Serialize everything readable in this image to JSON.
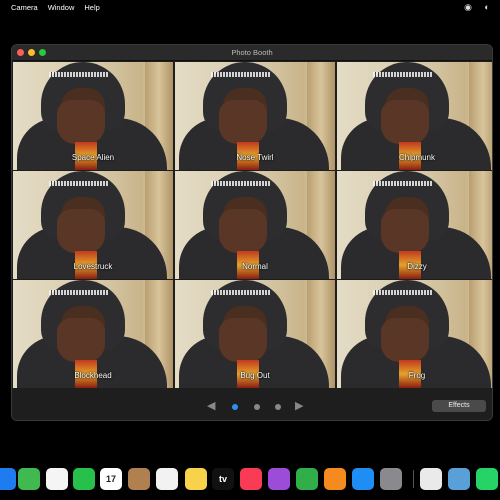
{
  "menubar": {
    "items": [
      "Camera",
      "Window",
      "Help"
    ],
    "status_icons": [
      "record-icon",
      "control-center-icon"
    ]
  },
  "window": {
    "title": "Photo Booth",
    "effects": [
      {
        "label": "Space Alien"
      },
      {
        "label": "Nose Twirl"
      },
      {
        "label": "Chipmunk"
      },
      {
        "label": "Lovestruck"
      },
      {
        "label": "Normal"
      },
      {
        "label": "Dizzy"
      },
      {
        "label": "Blockhead"
      },
      {
        "label": "Bug Out"
      },
      {
        "label": "Frog"
      }
    ],
    "pager": {
      "pages": 3,
      "current": 1
    },
    "effects_button": "Effects"
  },
  "dock": {
    "apps": [
      {
        "name": "finder-icon",
        "color": "#1e7bf0"
      },
      {
        "name": "maps-icon",
        "color": "#3fb950"
      },
      {
        "name": "photos-icon",
        "color": "#f5f5f5"
      },
      {
        "name": "facetime-icon",
        "color": "#27c04a"
      },
      {
        "name": "calendar-icon",
        "color": "#ffffff",
        "text": "17"
      },
      {
        "name": "contacts-icon",
        "color": "#b08050"
      },
      {
        "name": "reminders-icon",
        "color": "#f2f2f2"
      },
      {
        "name": "notes-icon",
        "color": "#f7d24a"
      },
      {
        "name": "apple-tv-icon",
        "color": "#111111",
        "text": "tv"
      },
      {
        "name": "music-icon",
        "color": "#fa3b55"
      },
      {
        "name": "podcasts-icon",
        "color": "#9c4dd8"
      },
      {
        "name": "numbers-icon",
        "color": "#2fae4a"
      },
      {
        "name": "pages-icon",
        "color": "#f58a1f"
      },
      {
        "name": "app-store-icon",
        "color": "#1e8ef5"
      },
      {
        "name": "system-settings-icon",
        "color": "#8a8a8e"
      },
      {
        "name": "chrome-icon",
        "color": "#eaeaea"
      },
      {
        "name": "preview-icon",
        "color": "#5aa0d8"
      },
      {
        "name": "whatsapp-icon",
        "color": "#25d366"
      }
    ]
  }
}
